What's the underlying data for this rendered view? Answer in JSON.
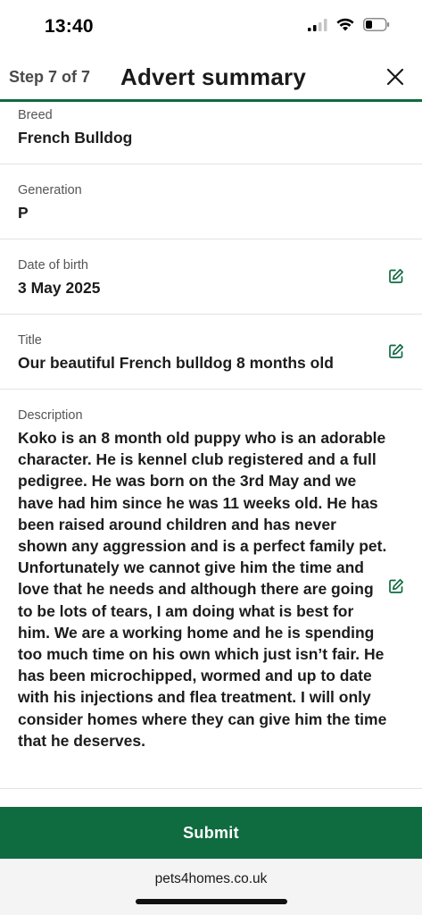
{
  "status_bar": {
    "time": "13:40"
  },
  "header": {
    "step": "Step 7 of 7",
    "title": "Advert summary"
  },
  "fields": [
    {
      "label": "Breed",
      "value": "French Bulldog",
      "editable": false
    },
    {
      "label": "Generation",
      "value": "P",
      "editable": false
    },
    {
      "label": "Date of birth",
      "value": "3 May 2025",
      "editable": true
    },
    {
      "label": "Title",
      "value": "Our beautiful French bulldog 8 months old",
      "editable": true
    },
    {
      "label": "Description",
      "value": "Koko is an 8 month old puppy who is an adorable character. He is kennel club registered and a full pedigree. He was born on the 3rd May and we have had him since he was 11 weeks old. He has been raised around children and has never shown any aggression and is a perfect family pet. Unfortunately we cannot give him the time and love that he needs and although there are going to be lots of tears, I am doing what is best for him. We are a working home and he is spending too much time on his own which just isn’t fair. He has been microchipped, wormed and up to date with his injections and flea treatment. I will only consider homes where they can give him the time that he deserves.",
      "editable": true
    }
  ],
  "submit": {
    "label": "Submit"
  },
  "footer": {
    "url": "pets4homes.co.uk"
  },
  "colors": {
    "brand_green": "#0f6b40",
    "footer_bg": "#f4f4f4"
  },
  "icons": {
    "close": "close-icon",
    "edit": "edit-icon"
  }
}
